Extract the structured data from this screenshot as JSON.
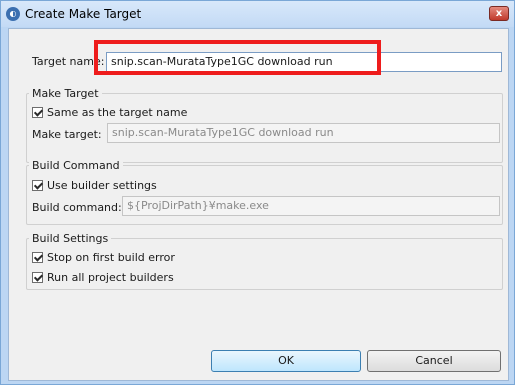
{
  "window": {
    "title": "Create Make Target",
    "app_icon": "eclipse-icon",
    "close_label": "x"
  },
  "target": {
    "label": "Target name:",
    "value": "snip.scan-MurataType1GC download run"
  },
  "make_target": {
    "group_label": "Make Target",
    "same_as_target_label": "Same as the target name",
    "same_as_target_checked": true,
    "field_label": "Make target:",
    "field_value": "snip.scan-MurataType1GC download run"
  },
  "build_command": {
    "group_label": "Build Command",
    "use_builder_label": "Use builder settings",
    "use_builder_checked": true,
    "field_label": "Build command:",
    "field_value": "${ProjDirPath}¥make.exe"
  },
  "build_settings": {
    "group_label": "Build Settings",
    "stop_on_error_label": "Stop on first build error",
    "stop_on_error_checked": true,
    "run_all_label": "Run all project builders",
    "run_all_checked": true
  },
  "buttons": {
    "ok_label": "OK",
    "cancel_label": "Cancel"
  },
  "annotation": {
    "highlight_color": "#ee1c1c"
  }
}
